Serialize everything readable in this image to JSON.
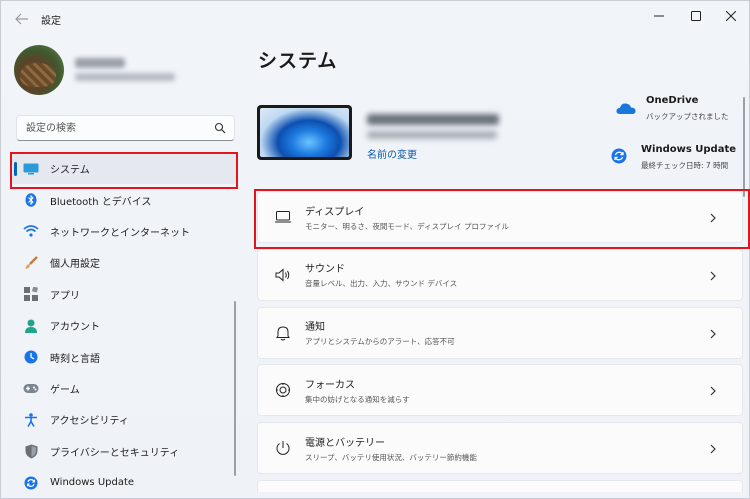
{
  "window": {
    "title": "設定",
    "back_icon": "back-arrow-icon",
    "controls": [
      "minimize-icon",
      "maximize-icon",
      "close-icon"
    ]
  },
  "sidebar": {
    "search_placeholder": "設定の検索",
    "items": [
      {
        "label": "システム",
        "icon": "system-icon",
        "selected": true
      },
      {
        "label": "Bluetooth とデバイス",
        "icon": "bluetooth-icon"
      },
      {
        "label": "ネットワークとインターネット",
        "icon": "wifi-icon"
      },
      {
        "label": "個人用設定",
        "icon": "brush-icon"
      },
      {
        "label": "アプリ",
        "icon": "apps-icon"
      },
      {
        "label": "アカウント",
        "icon": "account-icon"
      },
      {
        "label": "時刻と言語",
        "icon": "time-language-icon"
      },
      {
        "label": "ゲーム",
        "icon": "gamepad-icon"
      },
      {
        "label": "アクセシビリティ",
        "icon": "accessibility-icon"
      },
      {
        "label": "プライバシーとセキュリティ",
        "icon": "shield-icon"
      },
      {
        "label": "Windows Update",
        "icon": "windows-update-icon"
      }
    ]
  },
  "main": {
    "title": "システム",
    "device": {
      "rename_link": "名前の変更"
    },
    "onedrive": {
      "title": "OneDrive",
      "status": "バックアップされました"
    },
    "windows_update": {
      "title": "Windows Update",
      "status": "最終チェック日時: 7 時間"
    },
    "settings": [
      {
        "title": "ディスプレイ",
        "subtitle": "モニター、明るさ、夜間モード、ディスプレイ プロファイル",
        "icon": "display-icon"
      },
      {
        "title": "サウンド",
        "subtitle": "音量レベル、出力、入力、サウンド デバイス",
        "icon": "speaker-icon"
      },
      {
        "title": "通知",
        "subtitle": "アプリとシステムからのアラート、応答不可",
        "icon": "bell-icon"
      },
      {
        "title": "フォーカス",
        "subtitle": "集中の妨げとなる通知を減らす",
        "icon": "focus-icon"
      },
      {
        "title": "電源とバッテリー",
        "subtitle": "スリープ、バッテリ使用状況、バッテリー節約機能",
        "icon": "power-icon"
      }
    ]
  },
  "colors": {
    "accent": "#0067c0",
    "highlight": "#e3141c",
    "link": "#0a5aa8"
  }
}
